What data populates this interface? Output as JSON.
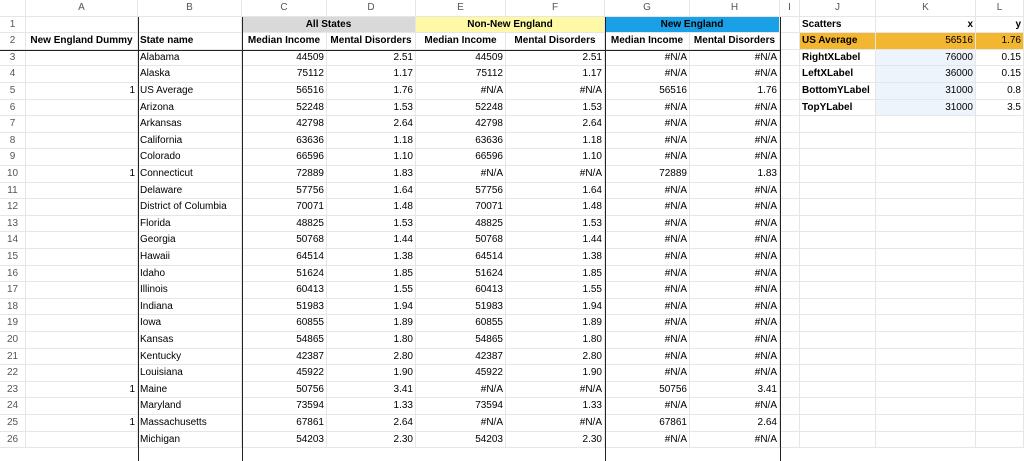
{
  "columns": [
    "A",
    "B",
    "C",
    "D",
    "E",
    "F",
    "G",
    "H",
    "I",
    "J",
    "K",
    "L"
  ],
  "group_headers": {
    "all_states": "All States",
    "non_new_england": "Non-New England",
    "new_england": "New England"
  },
  "header_row": {
    "a": "New England Dummy",
    "b": "State name",
    "c": "Median Income",
    "d": "Mental Disorders",
    "e": "Median Income",
    "f": "Mental Disorders",
    "g": "Median Income",
    "h": "Mental Disorders"
  },
  "scatters": {
    "title": "Scatters",
    "x_label": "x",
    "y_label": "y",
    "rows": [
      {
        "name": "US Average",
        "x": "56516",
        "y": "1.76"
      },
      {
        "name": "RightXLabel",
        "x": "76000",
        "y": "0.15"
      },
      {
        "name": "LeftXLabel",
        "x": "36000",
        "y": "0.15"
      },
      {
        "name": "BottomYLabel",
        "x": "31000",
        "y": "0.8"
      },
      {
        "name": "TopYLabel",
        "x": "31000",
        "y": "3.5"
      }
    ]
  },
  "rows": [
    {
      "n": "3",
      "a": "",
      "b": "Alabama",
      "c": "44509",
      "d": "2.51",
      "e": "44509",
      "f": "2.51",
      "g": "#N/A",
      "h": "#N/A"
    },
    {
      "n": "4",
      "a": "",
      "b": "Alaska",
      "c": "75112",
      "d": "1.17",
      "e": "75112",
      "f": "1.17",
      "g": "#N/A",
      "h": "#N/A"
    },
    {
      "n": "5",
      "a": "1",
      "b": "US Average",
      "c": "56516",
      "d": "1.76",
      "e": "#N/A",
      "f": "#N/A",
      "g": "56516",
      "h": "1.76"
    },
    {
      "n": "6",
      "a": "",
      "b": "Arizona",
      "c": "52248",
      "d": "1.53",
      "e": "52248",
      "f": "1.53",
      "g": "#N/A",
      "h": "#N/A"
    },
    {
      "n": "7",
      "a": "",
      "b": "Arkansas",
      "c": "42798",
      "d": "2.64",
      "e": "42798",
      "f": "2.64",
      "g": "#N/A",
      "h": "#N/A"
    },
    {
      "n": "8",
      "a": "",
      "b": "California",
      "c": "63636",
      "d": "1.18",
      "e": "63636",
      "f": "1.18",
      "g": "#N/A",
      "h": "#N/A"
    },
    {
      "n": "9",
      "a": "",
      "b": "Colorado",
      "c": "66596",
      "d": "1.10",
      "e": "66596",
      "f": "1.10",
      "g": "#N/A",
      "h": "#N/A"
    },
    {
      "n": "10",
      "a": "1",
      "b": "Connecticut",
      "c": "72889",
      "d": "1.83",
      "e": "#N/A",
      "f": "#N/A",
      "g": "72889",
      "h": "1.83"
    },
    {
      "n": "11",
      "a": "",
      "b": "Delaware",
      "c": "57756",
      "d": "1.64",
      "e": "57756",
      "f": "1.64",
      "g": "#N/A",
      "h": "#N/A"
    },
    {
      "n": "12",
      "a": "",
      "b": "District of Columbia",
      "c": "70071",
      "d": "1.48",
      "e": "70071",
      "f": "1.48",
      "g": "#N/A",
      "h": "#N/A"
    },
    {
      "n": "13",
      "a": "",
      "b": "Florida",
      "c": "48825",
      "d": "1.53",
      "e": "48825",
      "f": "1.53",
      "g": "#N/A",
      "h": "#N/A"
    },
    {
      "n": "14",
      "a": "",
      "b": "Georgia",
      "c": "50768",
      "d": "1.44",
      "e": "50768",
      "f": "1.44",
      "g": "#N/A",
      "h": "#N/A"
    },
    {
      "n": "15",
      "a": "",
      "b": "Hawaii",
      "c": "64514",
      "d": "1.38",
      "e": "64514",
      "f": "1.38",
      "g": "#N/A",
      "h": "#N/A"
    },
    {
      "n": "16",
      "a": "",
      "b": "Idaho",
      "c": "51624",
      "d": "1.85",
      "e": "51624",
      "f": "1.85",
      "g": "#N/A",
      "h": "#N/A"
    },
    {
      "n": "17",
      "a": "",
      "b": "Illinois",
      "c": "60413",
      "d": "1.55",
      "e": "60413",
      "f": "1.55",
      "g": "#N/A",
      "h": "#N/A"
    },
    {
      "n": "18",
      "a": "",
      "b": "Indiana",
      "c": "51983",
      "d": "1.94",
      "e": "51983",
      "f": "1.94",
      "g": "#N/A",
      "h": "#N/A"
    },
    {
      "n": "19",
      "a": "",
      "b": "Iowa",
      "c": "60855",
      "d": "1.89",
      "e": "60855",
      "f": "1.89",
      "g": "#N/A",
      "h": "#N/A"
    },
    {
      "n": "20",
      "a": "",
      "b": "Kansas",
      "c": "54865",
      "d": "1.80",
      "e": "54865",
      "f": "1.80",
      "g": "#N/A",
      "h": "#N/A"
    },
    {
      "n": "21",
      "a": "",
      "b": "Kentucky",
      "c": "42387",
      "d": "2.80",
      "e": "42387",
      "f": "2.80",
      "g": "#N/A",
      "h": "#N/A"
    },
    {
      "n": "22",
      "a": "",
      "b": "Louisiana",
      "c": "45922",
      "d": "1.90",
      "e": "45922",
      "f": "1.90",
      "g": "#N/A",
      "h": "#N/A"
    },
    {
      "n": "23",
      "a": "1",
      "b": "Maine",
      "c": "50756",
      "d": "3.41",
      "e": "#N/A",
      "f": "#N/A",
      "g": "50756",
      "h": "3.41"
    },
    {
      "n": "24",
      "a": "",
      "b": "Maryland",
      "c": "73594",
      "d": "1.33",
      "e": "73594",
      "f": "1.33",
      "g": "#N/A",
      "h": "#N/A"
    },
    {
      "n": "25",
      "a": "1",
      "b": "Massachusetts",
      "c": "67861",
      "d": "2.64",
      "e": "#N/A",
      "f": "#N/A",
      "g": "67861",
      "h": "2.64"
    },
    {
      "n": "26",
      "a": "",
      "b": "Michigan",
      "c": "54203",
      "d": "2.30",
      "e": "54203",
      "f": "2.30",
      "g": "#N/A",
      "h": "#N/A"
    }
  ]
}
